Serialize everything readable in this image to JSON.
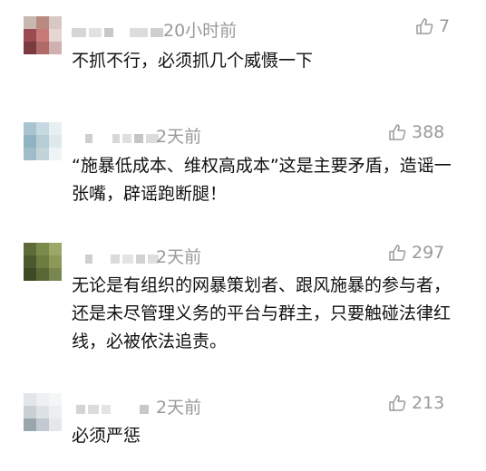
{
  "comments": [
    {
      "time": "20小时前",
      "likes": "7",
      "text": "不抓不行，必须抓几个威慑一下"
    },
    {
      "time": "2天前",
      "likes": "388",
      "text": "“施暴低成本、维权高成本”这是主要矛盾，造谣一张嘴，辟谣跑断腿！"
    },
    {
      "time": "2天前",
      "likes": "297",
      "text": "无论是有组织的网暴策划者、跟风施暴的参与者，还是未尽管理义务的平台与群主，只要触碰法律红线，必被依法追责。"
    },
    {
      "time": "2天前",
      "likes": "213",
      "text": "必须严惩"
    }
  ],
  "icons": {
    "like": "thumbs-up-icon"
  },
  "colors": {
    "meta": "#9a9a9a",
    "text": "#111111",
    "background": "#ffffff"
  }
}
